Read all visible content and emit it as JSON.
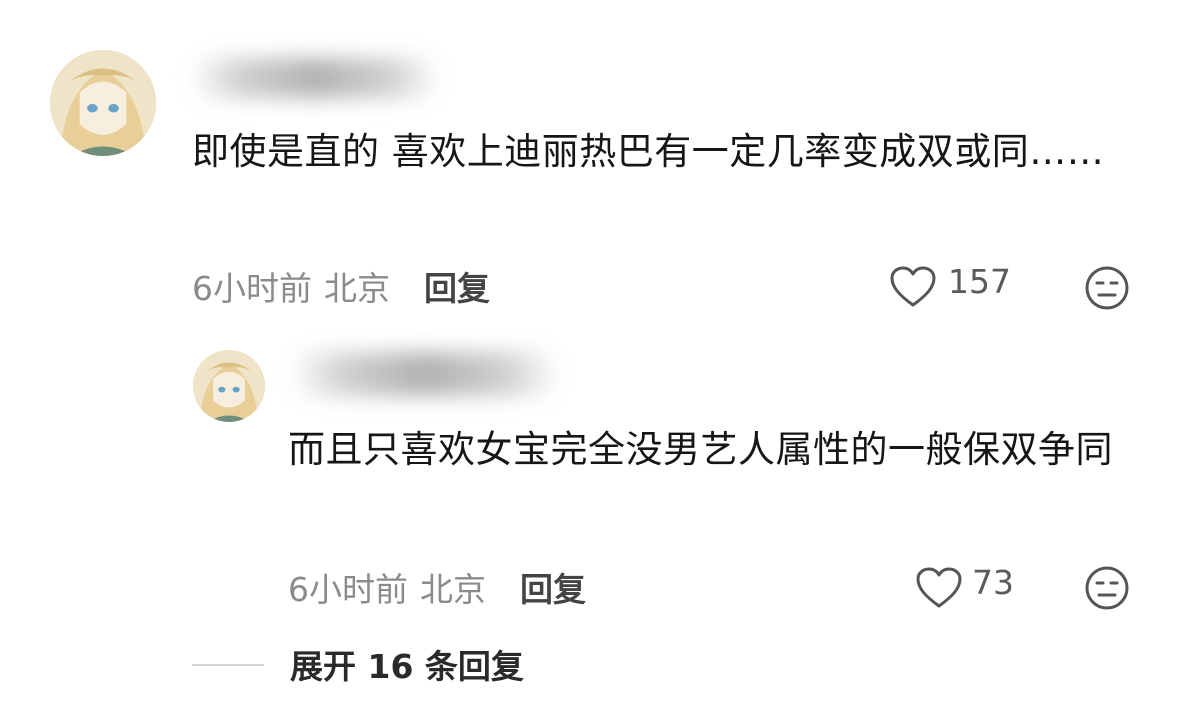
{
  "comment": {
    "text": "即使是直的 喜欢上迪丽热巴有一定几率变成双或同……",
    "time": "6小时前",
    "location": "北京",
    "reply_label": "回复",
    "likes": "157"
  },
  "reply": {
    "text": "而且只喜欢女宝完全没男艺人属性的一般保双争同",
    "time": "6小时前",
    "location": "北京",
    "reply_label": "回复",
    "likes": "73"
  },
  "expand_label": "展开 16 条回复",
  "icons": {
    "like": "heart-outline-icon",
    "dislike": "meh-face-icon"
  }
}
